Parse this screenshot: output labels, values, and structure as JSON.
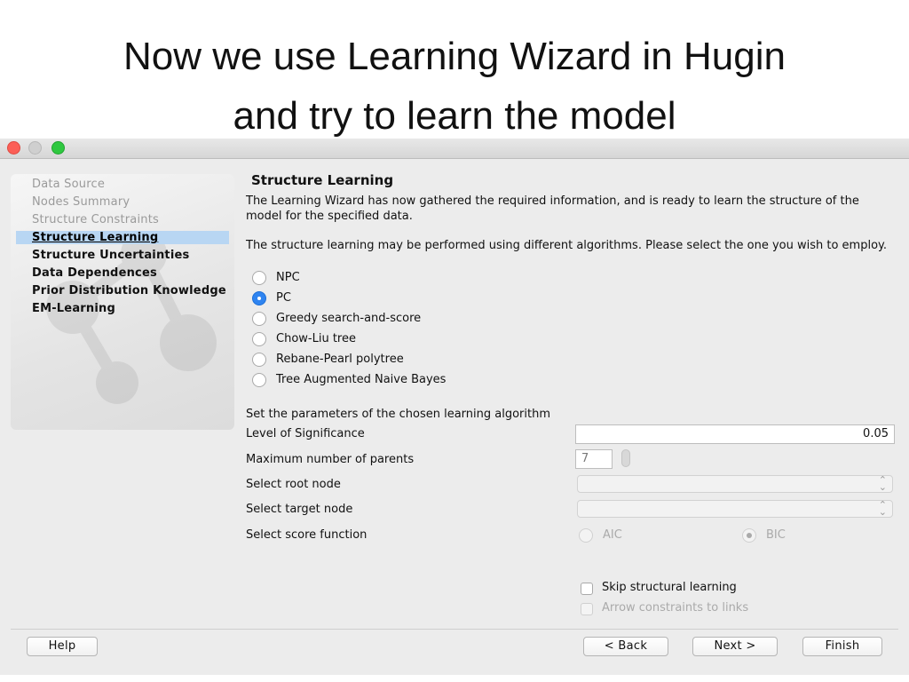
{
  "slide": {
    "title_line1": "Now we use Learning Wizard in Hugin",
    "title_line2": "and try to learn the model"
  },
  "sidebar": {
    "items": [
      {
        "label": "Data Source",
        "state": "done"
      },
      {
        "label": "Nodes Summary",
        "state": "done"
      },
      {
        "label": "Structure Constraints",
        "state": "done"
      },
      {
        "label": "Structure Learning",
        "state": "current"
      },
      {
        "label": "Structure Uncertainties",
        "state": "todo"
      },
      {
        "label": "Data Dependences",
        "state": "todo"
      },
      {
        "label": "Prior Distribution Knowledge",
        "state": "todo"
      },
      {
        "label": "EM-Learning",
        "state": "todo"
      }
    ]
  },
  "main": {
    "heading": "Structure Learning",
    "intro": "The Learning Wizard has now gathered the required information, and is ready to learn the structure of the model for the specified data.",
    "algo_prompt": "The structure learning may be performed using different algorithms. Please select the one you wish to employ.",
    "algorithms": [
      {
        "label": "NPC",
        "selected": false
      },
      {
        "label": "PC",
        "selected": true
      },
      {
        "label": "Greedy search-and-score",
        "selected": false
      },
      {
        "label": "Chow-Liu tree",
        "selected": false
      },
      {
        "label": "Rebane-Pearl polytree",
        "selected": false
      },
      {
        "label": "Tree Augmented Naive Bayes",
        "selected": false
      }
    ],
    "params_heading": "Set the parameters of the chosen learning algorithm",
    "significance_label": "Level of Significance",
    "significance_value": "0.05",
    "max_parents_label": "Maximum number of parents",
    "max_parents_value": "7",
    "root_node_label": "Select root node",
    "root_node_value": "",
    "target_node_label": "Select target node",
    "target_node_value": "",
    "score_function_label": "Select score function",
    "score_options": [
      {
        "label": "AIC",
        "selected": false
      },
      {
        "label": "BIC",
        "selected": true
      }
    ],
    "skip_label": "Skip structural learning",
    "skip_checked": false,
    "arrow_constraints_label": "Arrow constraints to links",
    "arrow_constraints_checked": false
  },
  "footer": {
    "help": "Help",
    "back": "< Back",
    "next": "Next >",
    "finish": "Finish"
  },
  "colors": {
    "selection": "#b8d6f3",
    "radio_selected": "#2f84f0",
    "window_bg": "#ececec"
  }
}
